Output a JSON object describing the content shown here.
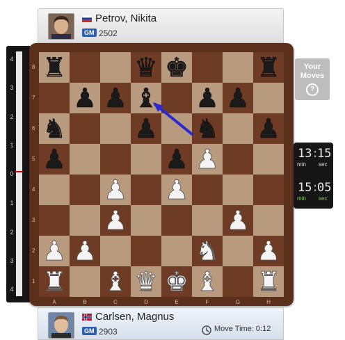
{
  "top_player": {
    "name": "Petrov, Nikita",
    "title": "GM",
    "rating": "2502",
    "flag": "russia"
  },
  "bottom_player": {
    "name": "Carlsen, Magnus",
    "title": "GM",
    "rating": "2903",
    "flag": "norway"
  },
  "eval_bar": {
    "ticks": [
      "4",
      "3",
      "2",
      "1",
      "0",
      "1",
      "2",
      "3",
      "4"
    ],
    "value": 0
  },
  "board": {
    "files": [
      "A",
      "B",
      "C",
      "D",
      "E",
      "F",
      "G",
      "H"
    ],
    "ranks": [
      "8",
      "7",
      "6",
      "5",
      "4",
      "3",
      "2",
      "1"
    ],
    "squares": [
      [
        "bR",
        "",
        "",
        "bQ",
        "bK",
        "",
        "",
        "bR"
      ],
      [
        "",
        "bP",
        "bP",
        "bB",
        "",
        "bP",
        "bP",
        ""
      ],
      [
        "bN",
        "",
        "",
        "bP",
        "",
        "bN",
        "",
        "bP"
      ],
      [
        "bP",
        "",
        "",
        "",
        "bP",
        "wP",
        "",
        ""
      ],
      [
        "",
        "",
        "wP",
        "",
        "wP",
        "",
        "",
        ""
      ],
      [
        "",
        "",
        "wP",
        "",
        "",
        "",
        "wP",
        ""
      ],
      [
        "wP",
        "wP",
        "",
        "",
        "",
        "wN",
        "",
        "wP"
      ],
      [
        "wR",
        "",
        "wB",
        "wQ",
        "wK",
        "wB",
        "",
        "wR"
      ]
    ],
    "arrow": {
      "from": "e6",
      "to": "d7"
    },
    "light_color": "#b89a7e",
    "dark_color": "#6e3b24"
  },
  "your_moves": {
    "line1": "Your",
    "line2": "Moves",
    "help": "?"
  },
  "clock": {
    "top_min": "13",
    "top_sec": "15",
    "bottom_min": "15",
    "bottom_sec": "05",
    "min_label": "min",
    "sec_label": "sec"
  },
  "move_time": {
    "label": "Move Time: 0:12"
  },
  "icons": {
    "clock": "clock-icon",
    "help": "help-icon"
  }
}
